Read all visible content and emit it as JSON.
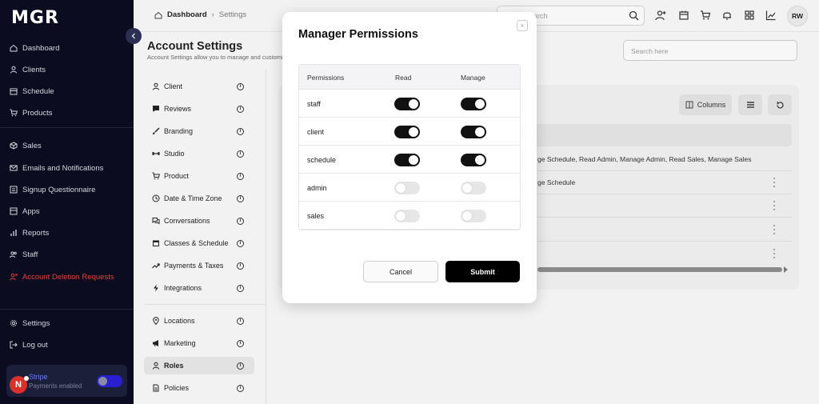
{
  "sidebar": {
    "logo": "MGR",
    "items": [
      {
        "label": "Dashboard"
      },
      {
        "label": "Clients"
      },
      {
        "label": "Schedule"
      },
      {
        "label": "Products"
      },
      {
        "label": "Sales"
      },
      {
        "label": "Emails and Notifications"
      },
      {
        "label": "Signup Questionnaire"
      },
      {
        "label": "Apps"
      },
      {
        "label": "Reports"
      },
      {
        "label": "Staff"
      },
      {
        "label": "Account Deletion Requests"
      }
    ],
    "bottom_items": [
      {
        "label": "Settings"
      },
      {
        "label": "Log out"
      }
    ],
    "stripe": {
      "name": "Stripe",
      "status": "Payments enabled"
    },
    "badge": "N"
  },
  "topbar": {
    "breadcrumb": {
      "root": "Dashboard",
      "separator": "›",
      "current": "Settings"
    },
    "search_placeholder": "Search",
    "avatar_initials": "RW"
  },
  "page": {
    "title": "Account Settings",
    "subtitle": "Account Settings allow you to manage and customize",
    "search_placeholder": "Search here"
  },
  "settings_menu": {
    "items": [
      {
        "label": "Client"
      },
      {
        "label": "Reviews"
      },
      {
        "label": "Branding"
      },
      {
        "label": "Studio"
      },
      {
        "label": "Product"
      },
      {
        "label": "Date & Time Zone"
      },
      {
        "label": "Conversations"
      },
      {
        "label": "Classes & Schedule"
      },
      {
        "label": "Payments & Taxes"
      },
      {
        "label": "Integrations"
      },
      {
        "label": "Locations"
      },
      {
        "label": "Marketing"
      },
      {
        "label": "Roles"
      },
      {
        "label": "Policies"
      }
    ],
    "info_glyph": "i"
  },
  "content": {
    "columns_label": "Columns",
    "rows": [
      "ge Schedule, Read Admin, Manage Admin, Read Sales, Manage Sales",
      "ge Schedule"
    ]
  },
  "modal": {
    "title": "Manager Permissions",
    "close_glyph": "×",
    "headers": {
      "permissions": "Permissions",
      "read": "Read",
      "manage": "Manage"
    },
    "permissions": [
      {
        "name": "staff",
        "read": true,
        "manage": true
      },
      {
        "name": "client",
        "read": true,
        "manage": true
      },
      {
        "name": "schedule",
        "read": true,
        "manage": true
      },
      {
        "name": "admin",
        "read": false,
        "manage": false
      },
      {
        "name": "sales",
        "read": false,
        "manage": false
      }
    ],
    "cancel_label": "Cancel",
    "submit_label": "Submit"
  },
  "colors": {
    "sidebar_bg": "#0b0c1f",
    "danger": "#e0463a",
    "toggle_on": "#111111",
    "toggle_off": "#e6e6e6",
    "submit_bg": "#000000"
  }
}
